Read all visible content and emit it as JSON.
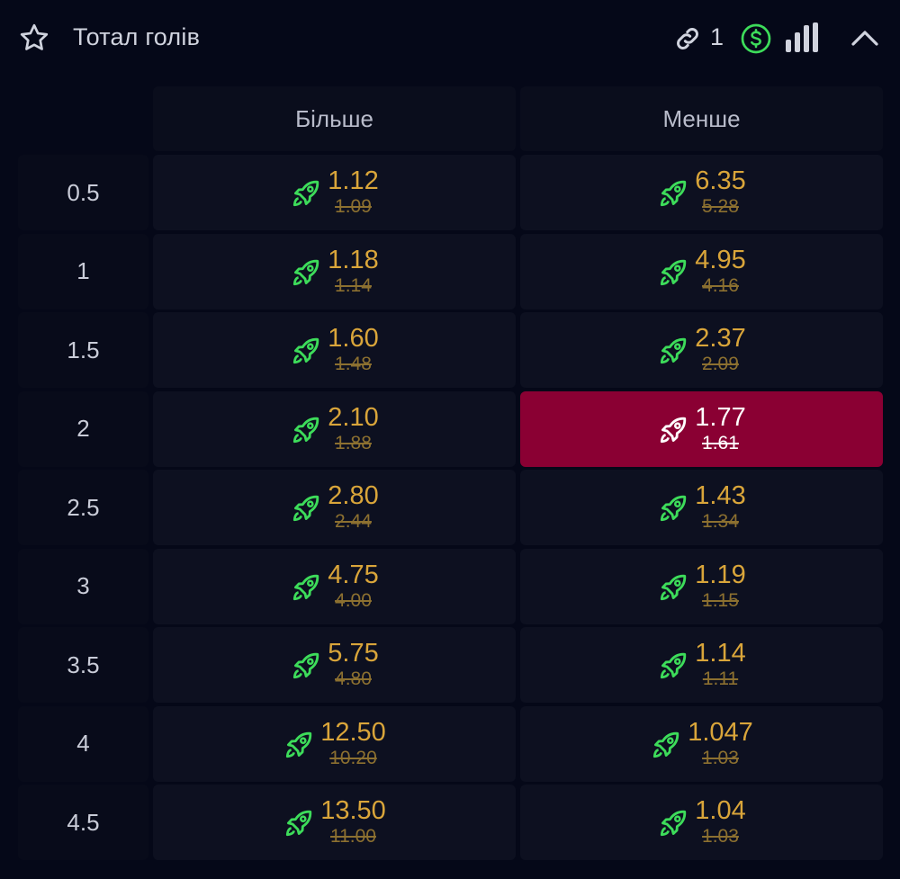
{
  "header": {
    "title": "Тотал голів",
    "link_count": "1"
  },
  "columns": {
    "over": "Більше",
    "under": "Менше"
  },
  "colors": {
    "background": "#050818",
    "odds_new": "#d9a53a",
    "odds_old": "#8c7030",
    "boost_icon": "#3ddc5a",
    "selected": "#8a0033"
  },
  "rows": [
    {
      "line": "0.5",
      "over": {
        "new": "1.12",
        "old": "1.09"
      },
      "under": {
        "new": "6.35",
        "old": "5.28"
      }
    },
    {
      "line": "1",
      "over": {
        "new": "1.18",
        "old": "1.14"
      },
      "under": {
        "new": "4.95",
        "old": "4.16"
      }
    },
    {
      "line": "1.5",
      "over": {
        "new": "1.60",
        "old": "1.48"
      },
      "under": {
        "new": "2.37",
        "old": "2.09"
      }
    },
    {
      "line": "2",
      "over": {
        "new": "2.10",
        "old": "1.88"
      },
      "under": {
        "new": "1.77",
        "old": "1.61",
        "selected": true
      }
    },
    {
      "line": "2.5",
      "over": {
        "new": "2.80",
        "old": "2.44"
      },
      "under": {
        "new": "1.43",
        "old": "1.34"
      }
    },
    {
      "line": "3",
      "over": {
        "new": "4.75",
        "old": "4.00"
      },
      "under": {
        "new": "1.19",
        "old": "1.15"
      }
    },
    {
      "line": "3.5",
      "over": {
        "new": "5.75",
        "old": "4.80"
      },
      "under": {
        "new": "1.14",
        "old": "1.11"
      }
    },
    {
      "line": "4",
      "over": {
        "new": "12.50",
        "old": "10.20"
      },
      "under": {
        "new": "1.047",
        "old": "1.03"
      }
    },
    {
      "line": "4.5",
      "over": {
        "new": "13.50",
        "old": "11.00"
      },
      "under": {
        "new": "1.04",
        "old": "1.03"
      }
    }
  ]
}
